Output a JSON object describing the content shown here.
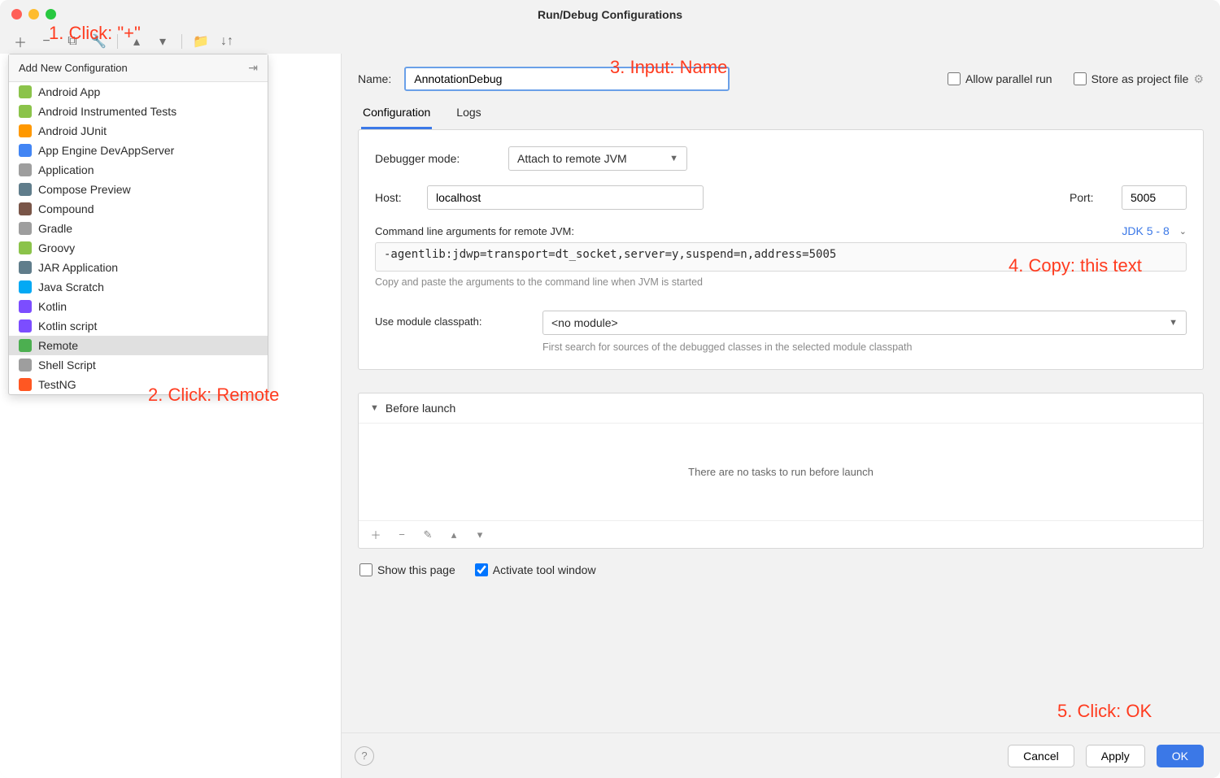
{
  "window": {
    "title": "Run/Debug Configurations"
  },
  "toolbar": {
    "icons": [
      "plus-icon",
      "minus-icon",
      "copy-icon",
      "wrench-icon",
      "caret-up-icon",
      "caret-down-icon",
      "folder-icon",
      "sort-icon"
    ]
  },
  "dropdown": {
    "title": "Add New Configuration",
    "items": [
      {
        "label": "Android App",
        "icon": "#8bc34a"
      },
      {
        "label": "Android Instrumented Tests",
        "icon": "#8bc34a"
      },
      {
        "label": "Android JUnit",
        "icon": "#ff9800"
      },
      {
        "label": "App Engine DevAppServer",
        "icon": "#4285f4"
      },
      {
        "label": "Application",
        "icon": "#9e9e9e"
      },
      {
        "label": "Compose Preview",
        "icon": "#607d8b"
      },
      {
        "label": "Compound",
        "icon": "#795548"
      },
      {
        "label": "Gradle",
        "icon": "#9e9e9e"
      },
      {
        "label": "Groovy",
        "icon": "#8bc34a"
      },
      {
        "label": "JAR Application",
        "icon": "#607d8b"
      },
      {
        "label": "Java Scratch",
        "icon": "#03a9f4"
      },
      {
        "label": "Kotlin",
        "icon": "#7c4dff"
      },
      {
        "label": "Kotlin script",
        "icon": "#7c4dff"
      },
      {
        "label": "Remote",
        "icon": "#4caf50",
        "selected": true
      },
      {
        "label": "Shell Script",
        "icon": "#9e9e9e"
      },
      {
        "label": "TestNG",
        "icon": "#ff5722"
      }
    ]
  },
  "form": {
    "name_label": "Name:",
    "name_value": "AnnotationDebug",
    "allow_parallel": "Allow parallel run",
    "store_as_project": "Store as project file",
    "tabs": [
      "Configuration",
      "Logs"
    ],
    "debugger_mode_label": "Debugger mode:",
    "debugger_mode_value": "Attach to remote JVM",
    "host_label": "Host:",
    "host_value": "localhost",
    "port_label": "Port:",
    "port_value": "5005",
    "cmdline_label": "Command line arguments for remote JVM:",
    "jdk_label": "JDK 5 - 8",
    "cmdline_value": "-agentlib:jdwp=transport=dt_socket,server=y,suspend=n,address=5005",
    "cmdline_hint": "Copy and paste the arguments to the command line when JVM is started",
    "module_label": "Use module classpath:",
    "module_value": "<no module>",
    "module_hint": "First search for sources of the debugged classes in the selected module classpath"
  },
  "before_launch": {
    "title": "Before launch",
    "empty": "There are no tasks to run before launch",
    "show_page": "Show this page",
    "activate_window": "Activate tool window"
  },
  "footer": {
    "cancel": "Cancel",
    "apply": "Apply",
    "ok": "OK"
  },
  "annotations": {
    "a1": "1. Click: \"+\"",
    "a2": "2. Click: Remote",
    "a3": "3. Input: Name",
    "a4": "4. Copy: this text",
    "a5": "5. Click: OK"
  }
}
